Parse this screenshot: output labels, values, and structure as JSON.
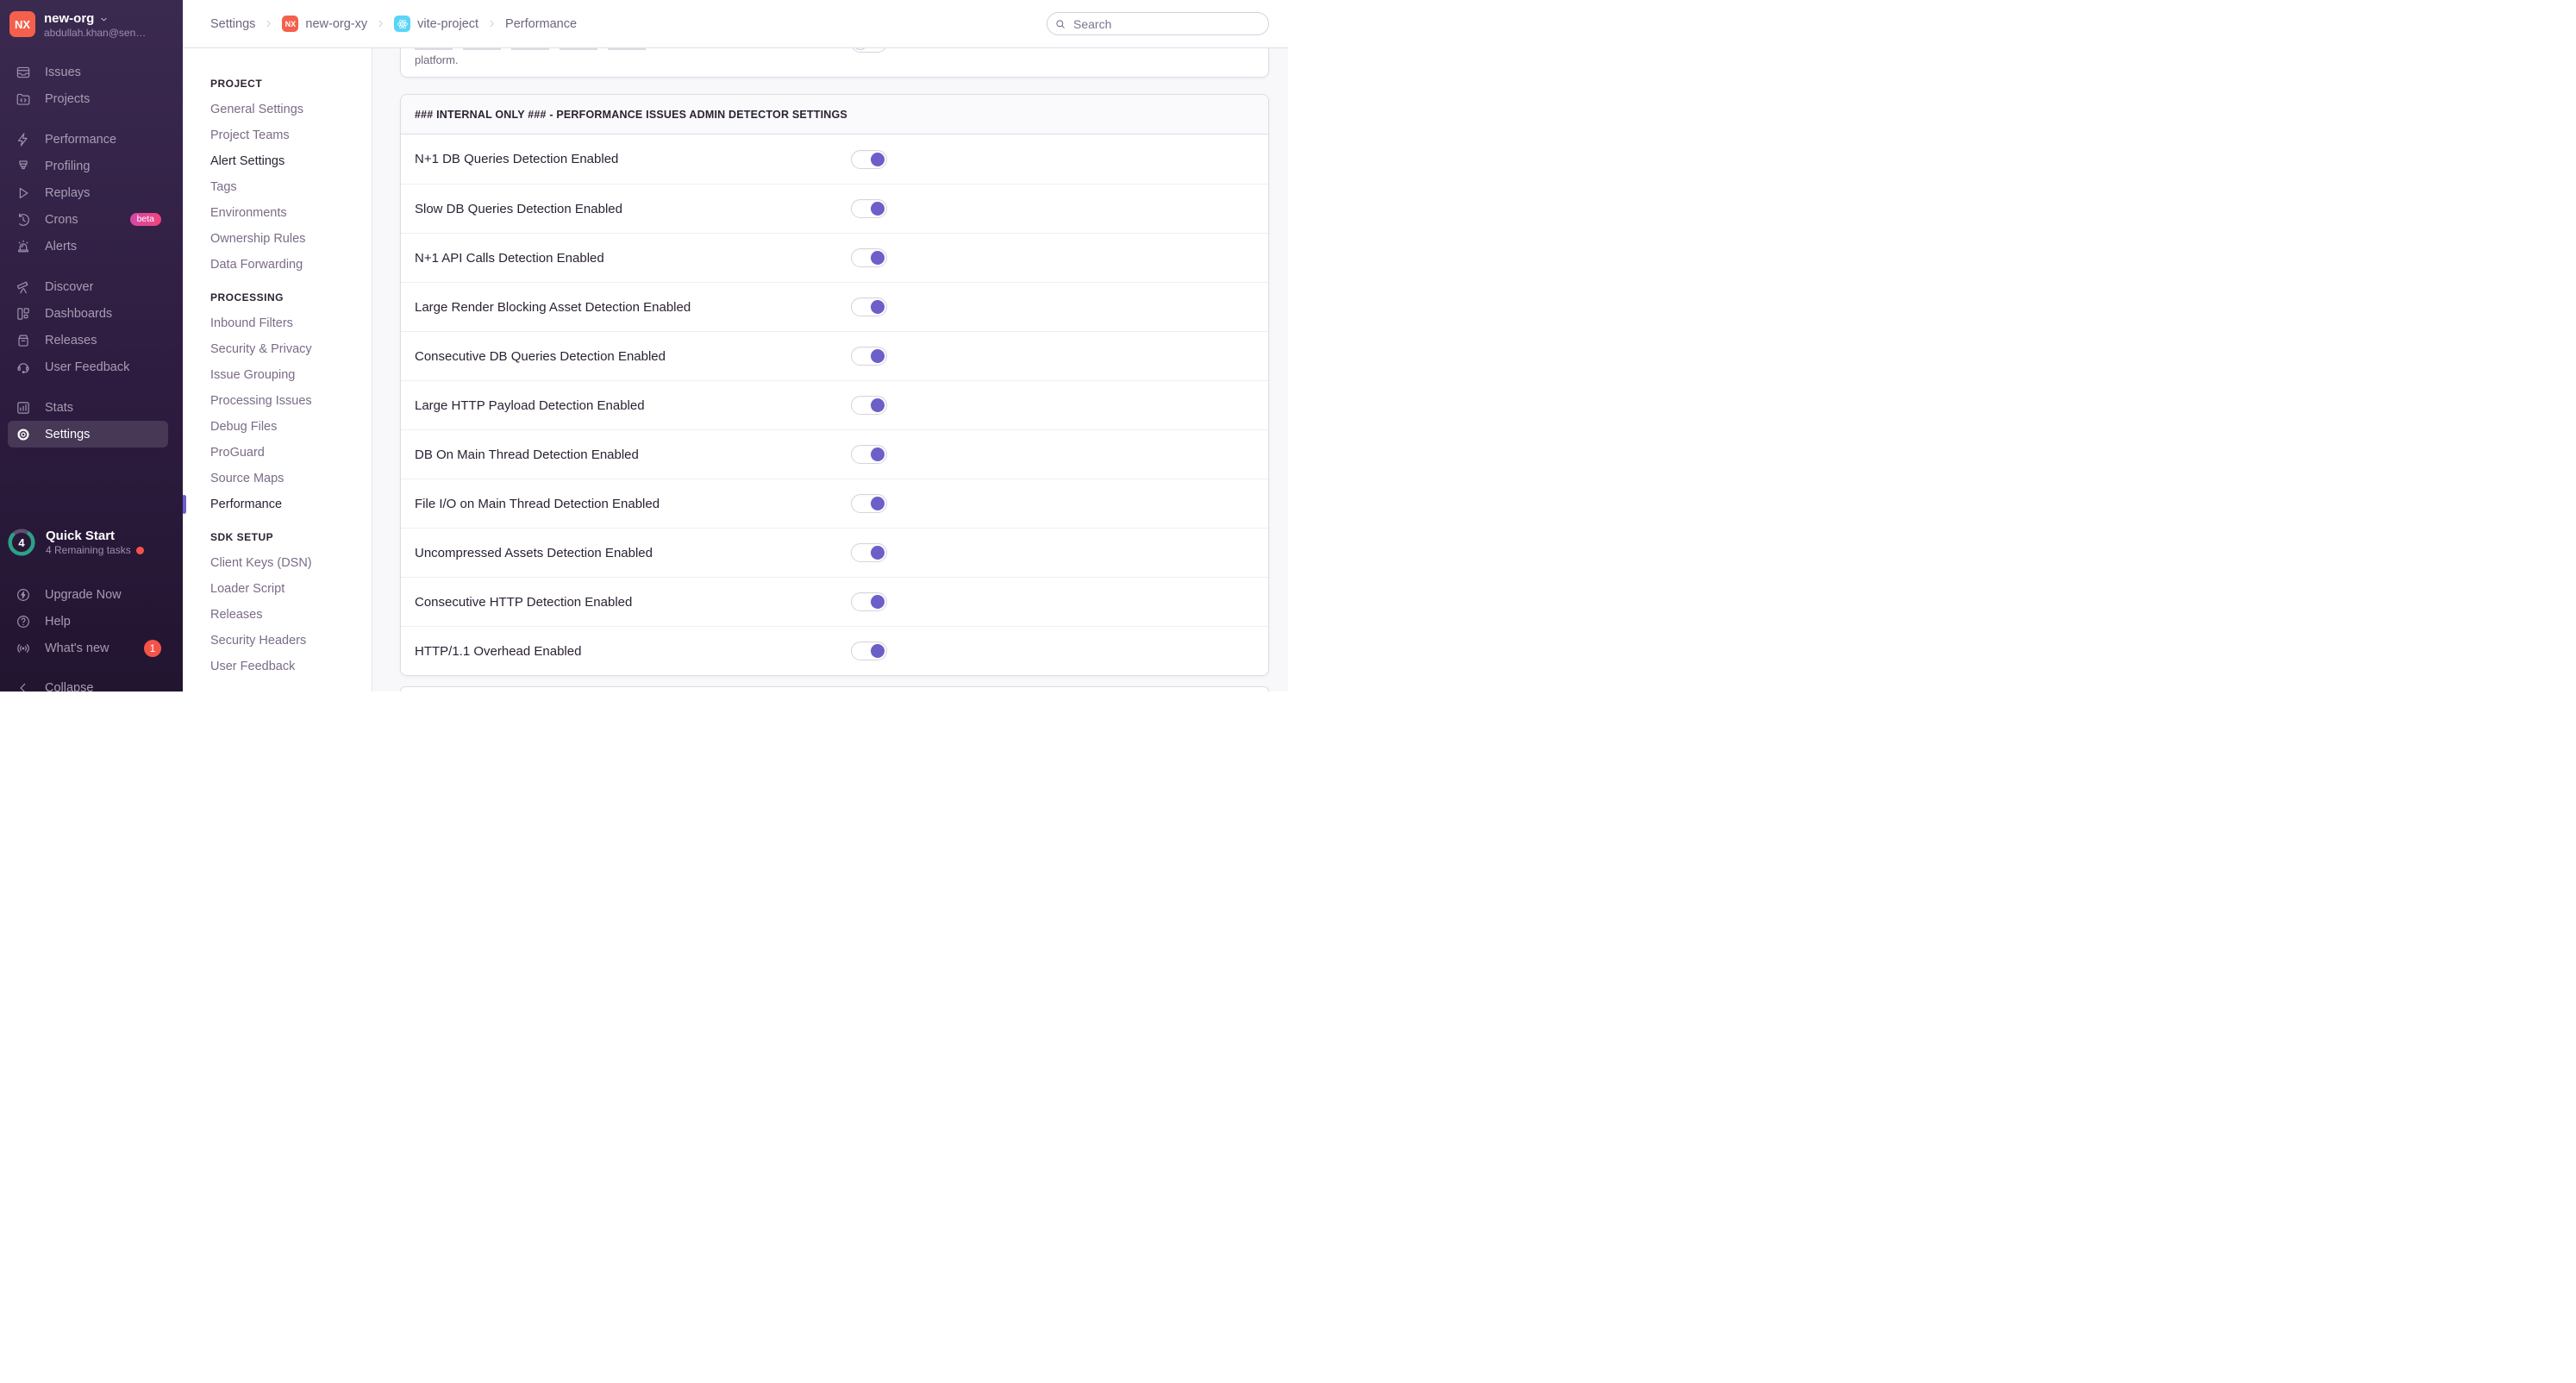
{
  "colors": {
    "accent": "#6C5FC7",
    "org_avatar": "#F4604C",
    "badge_red": "#F55349",
    "beta_start": "#D348A8",
    "beta_end": "#F1447E",
    "react_cyan": "#58D5F7",
    "quickstart_teal": "#2BA185",
    "sidebar_top": "#3B2A50",
    "sidebar_bottom": "#221530",
    "content_bg": "#F8F7FA",
    "panel_border": "#E0DBE6",
    "panel_header_bg": "#FAF9FB",
    "row_divider": "#F1EDF4",
    "header_border": "#E2DDE8",
    "nav_divider": "#E8E3ED",
    "toggle_border": "#D8D2DE"
  },
  "sidebar": {
    "org": {
      "initials": "NX",
      "name": "new-org",
      "email": "abdullah.khan@sen…"
    },
    "primary_nav": [
      [
        {
          "icon": "issues-icon",
          "label": "Issues"
        },
        {
          "icon": "projects-icon",
          "label": "Projects"
        }
      ],
      [
        {
          "icon": "lightning-icon",
          "label": "Performance"
        },
        {
          "icon": "profiling-icon",
          "label": "Profiling"
        },
        {
          "icon": "play-icon",
          "label": "Replays"
        },
        {
          "icon": "clock-icon",
          "label": "Crons",
          "badge": {
            "text": "beta",
            "style": "beta"
          }
        },
        {
          "icon": "siren-icon",
          "label": "Alerts"
        }
      ],
      [
        {
          "icon": "telescope-icon",
          "label": "Discover"
        },
        {
          "icon": "dashboards-icon",
          "label": "Dashboards"
        },
        {
          "icon": "releases-icon",
          "label": "Releases"
        },
        {
          "icon": "feedback-icon",
          "label": "User Feedback"
        }
      ],
      [
        {
          "icon": "stats-icon",
          "label": "Stats"
        },
        {
          "icon": "gear-icon",
          "label": "Settings",
          "active": true
        }
      ]
    ],
    "quick_start": {
      "count": "4",
      "title": "Quick Start",
      "subtitle": "4 Remaining tasks"
    },
    "footer_nav": [
      {
        "icon": "upgrade-icon",
        "label": "Upgrade Now"
      },
      {
        "icon": "help-icon",
        "label": "Help"
      },
      {
        "icon": "broadcast-icon",
        "label": "What's new",
        "badge": {
          "text": "1",
          "style": "count"
        }
      }
    ],
    "collapse": {
      "icon": "collapse-icon",
      "label": "Collapse"
    }
  },
  "header": {
    "breadcrumbs": [
      {
        "label": "Settings"
      },
      {
        "label": "new-org-xy",
        "icon": "org-avatar-icon",
        "icon_text": "NX"
      },
      {
        "label": "vite-project",
        "icon": "react-icon"
      },
      {
        "label": "Performance"
      }
    ],
    "search_placeholder": "Search"
  },
  "settings_nav": {
    "sections": [
      {
        "title": "PROJECT",
        "items": [
          {
            "label": "General Settings"
          },
          {
            "label": "Project Teams"
          },
          {
            "label": "Alert Settings",
            "state": "emphasis"
          },
          {
            "label": "Tags"
          },
          {
            "label": "Environments"
          },
          {
            "label": "Ownership Rules"
          },
          {
            "label": "Data Forwarding"
          }
        ]
      },
      {
        "title": "PROCESSING",
        "items": [
          {
            "label": "Inbound Filters"
          },
          {
            "label": "Security & Privacy"
          },
          {
            "label": "Issue Grouping"
          },
          {
            "label": "Processing Issues"
          },
          {
            "label": "Debug Files"
          },
          {
            "label": "ProGuard"
          },
          {
            "label": "Source Maps"
          },
          {
            "label": "Performance",
            "state": "active"
          }
        ]
      },
      {
        "title": "SDK SETUP",
        "items": [
          {
            "label": "Client Keys (DSN)"
          },
          {
            "label": "Loader Script"
          },
          {
            "label": "Releases"
          },
          {
            "label": "Security Headers"
          },
          {
            "label": "User Feedback"
          }
        ]
      }
    ]
  },
  "main": {
    "cut_panel": {
      "visible_text": "platform.",
      "toggle_on": false
    },
    "panel": {
      "title": "### INTERNAL ONLY ### - PERFORMANCE ISSUES ADMIN DETECTOR SETTINGS",
      "rows": [
        {
          "label": "N+1 DB Queries Detection Enabled",
          "on": true
        },
        {
          "label": "Slow DB Queries Detection Enabled",
          "on": true
        },
        {
          "label": "N+1 API Calls Detection Enabled",
          "on": true
        },
        {
          "label": "Large Render Blocking Asset Detection Enabled",
          "on": true
        },
        {
          "label": "Consecutive DB Queries Detection Enabled",
          "on": true
        },
        {
          "label": "Large HTTP Payload Detection Enabled",
          "on": true
        },
        {
          "label": "DB On Main Thread Detection Enabled",
          "on": true
        },
        {
          "label": "File I/O on Main Thread Detection Enabled",
          "on": true
        },
        {
          "label": "Uncompressed Assets Detection Enabled",
          "on": true
        },
        {
          "label": "Consecutive HTTP Detection Enabled",
          "on": true
        },
        {
          "label": "HTTP/1.1 Overhead Enabled",
          "on": true
        }
      ]
    }
  }
}
